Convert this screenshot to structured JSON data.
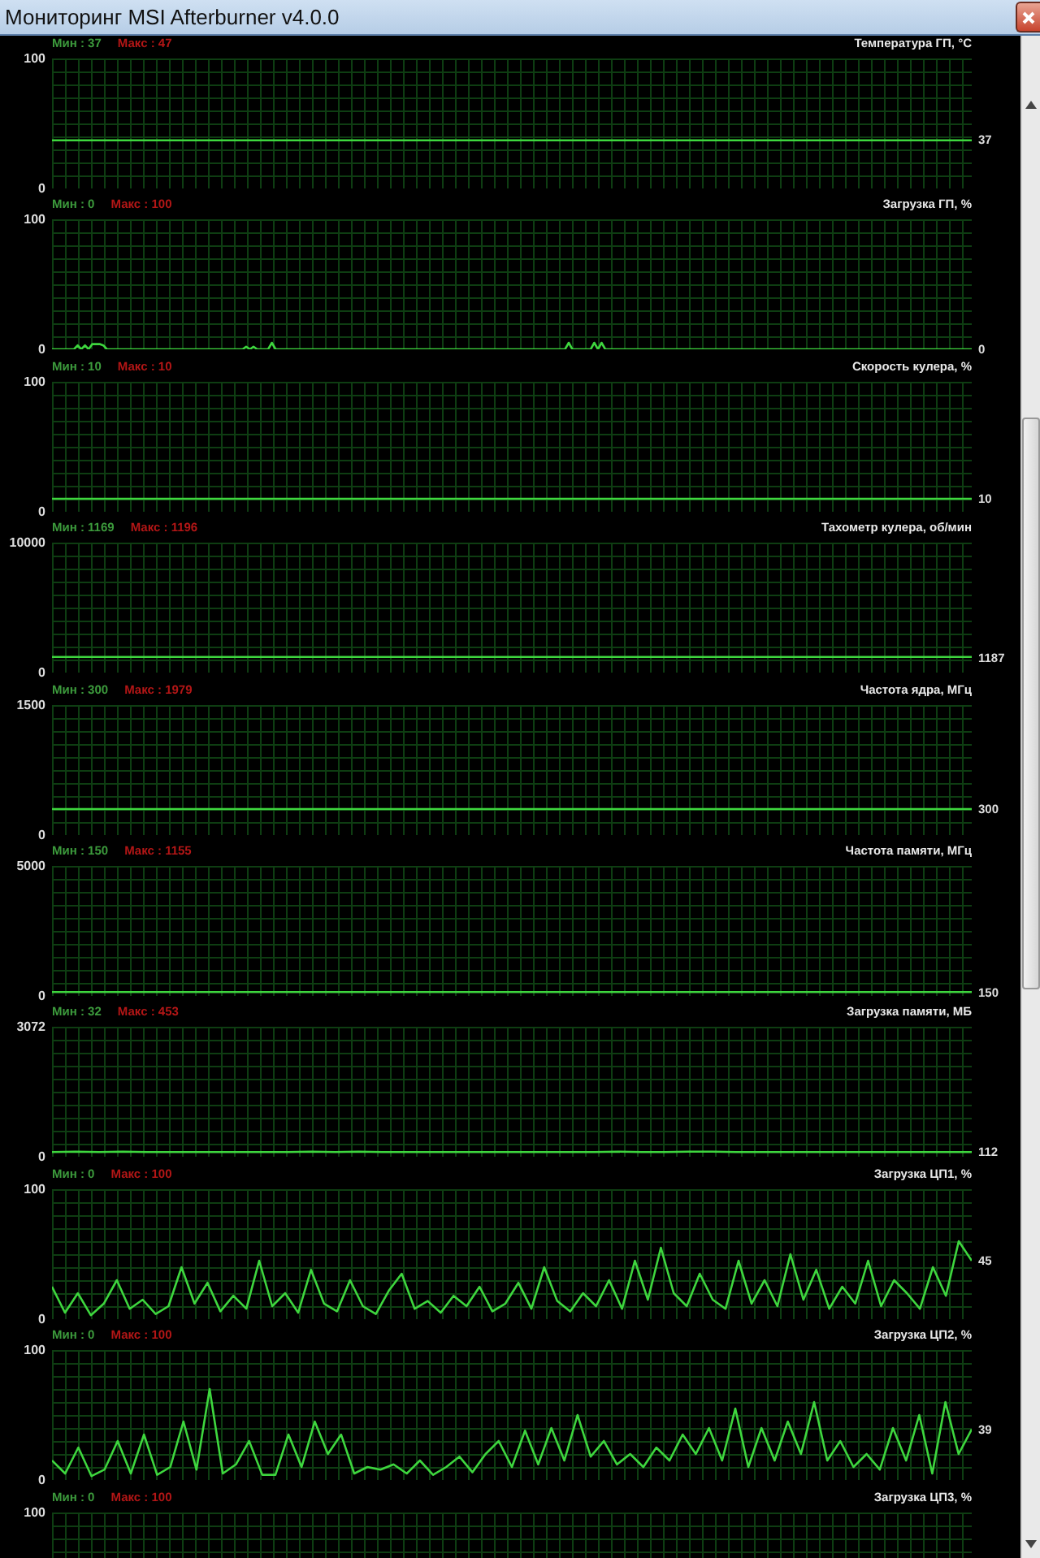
{
  "window": {
    "title": "Мониторинг MSI Afterburner v4.0.0"
  },
  "graphs": [
    {
      "min": "Мин : 37",
      "max": "Макс : 47",
      "title": "Температура ГП, °C",
      "current": "37",
      "chart_data": {
        "type": "line",
        "grid": true,
        "ylim": [
          0,
          100
        ],
        "yticks": [
          0,
          100
        ],
        "series": [
          {
            "color": "#3ed63e",
            "values": [
              37,
              37,
              37,
              37,
              37,
              37,
              37,
              37,
              37,
              37,
              37,
              37,
              37,
              37,
              37,
              37,
              37,
              37,
              37,
              37
            ]
          }
        ]
      }
    },
    {
      "min": "Мин : 0",
      "max": "Макс : 100",
      "title": "Загрузка ГП, %",
      "current": "0",
      "chart_data": {
        "type": "line",
        "grid": true,
        "ylim": [
          0,
          100
        ],
        "yticks": [
          0,
          100
        ],
        "series": [
          {
            "color": "#3ed63e",
            "values": [
              0,
              0,
              0,
              0,
              0,
              0,
              0,
              3,
              0,
              3,
              0,
              4,
              4,
              4,
              3,
              0,
              0,
              0,
              0,
              0,
              0,
              0,
              0,
              0,
              0,
              0,
              0,
              0,
              0,
              0,
              0,
              0,
              0,
              0,
              0,
              0,
              0,
              0,
              0,
              0,
              0,
              0,
              0,
              0,
              0,
              0,
              0,
              0,
              0,
              0,
              0,
              0,
              0,
              2,
              0,
              2,
              0,
              0,
              0,
              0,
              5,
              0,
              0,
              0,
              0,
              0,
              0,
              0,
              0,
              0,
              0,
              0,
              0,
              0,
              0,
              0,
              0,
              0,
              0,
              0,
              0,
              0,
              0,
              0,
              0,
              0,
              0,
              0,
              0,
              0,
              0,
              0,
              0,
              0,
              0,
              0,
              0,
              0,
              0,
              0,
              0,
              0,
              0,
              0,
              0,
              0,
              0,
              0,
              0,
              0,
              0,
              0,
              0,
              0,
              0,
              0,
              0,
              0,
              0,
              0,
              0,
              0,
              0,
              0,
              0,
              0,
              0,
              0,
              0,
              0,
              0,
              0,
              0,
              0,
              0,
              0,
              0,
              0,
              0,
              0,
              0,
              5,
              0,
              0,
              0,
              0,
              0,
              0,
              5,
              0,
              5,
              0,
              0,
              0,
              0,
              0,
              0,
              0,
              0,
              0,
              0,
              0,
              0,
              0,
              0,
              0,
              0,
              0,
              0,
              0,
              0,
              0,
              0,
              0,
              0,
              0,
              0,
              0,
              0,
              0,
              0,
              0,
              0,
              0,
              0,
              0,
              0,
              0,
              0,
              0,
              0,
              0,
              0,
              0,
              0,
              0,
              0,
              0,
              0,
              0,
              0,
              0,
              0,
              0,
              0,
              0,
              0,
              0,
              0,
              0,
              0,
              0,
              0,
              0,
              0,
              0,
              0,
              0,
              0,
              0,
              0,
              0,
              0,
              0,
              0,
              0,
              0,
              0,
              0,
              0,
              0,
              0,
              0,
              0,
              0,
              0,
              0,
              0,
              0,
              0,
              0,
              0,
              0,
              0,
              0,
              0,
              0,
              0,
              0,
              0,
              0,
              0
            ]
          }
        ]
      }
    },
    {
      "min": "Мин : 10",
      "max": "Макс : 10",
      "title": "Скорость кулера, %",
      "current": "10",
      "chart_data": {
        "type": "line",
        "grid": true,
        "ylim": [
          0,
          100
        ],
        "yticks": [
          0,
          100
        ],
        "series": [
          {
            "color": "#3ed63e",
            "values": [
              10,
              10,
              10,
              10,
              10,
              10,
              10,
              10,
              10,
              10,
              10,
              10,
              10,
              10,
              10,
              10,
              10,
              10,
              10,
              10
            ]
          }
        ]
      }
    },
    {
      "min": "Мин : 1169",
      "max": "Макс : 1196",
      "title": "Тахометр кулера, об/мин",
      "current": "1187",
      "chart_data": {
        "type": "line",
        "grid": true,
        "ylim": [
          0,
          10000
        ],
        "yticks": [
          0,
          10000
        ],
        "series": [
          {
            "color": "#3ed63e",
            "values": [
              1200,
              1200,
              1200,
              1200,
              1200,
              1200,
              1200,
              1200,
              1200,
              1200,
              1200,
              1200,
              1200,
              1200,
              1200,
              1200,
              1200,
              1200,
              1200,
              1200
            ]
          }
        ]
      }
    },
    {
      "min": "Мин : 300",
      "max": "Макс : 1979",
      "title": "Частота ядра, МГц",
      "current": "300",
      "chart_data": {
        "type": "line",
        "grid": true,
        "ylim": [
          0,
          1500
        ],
        "yticks": [
          0,
          1500
        ],
        "series": [
          {
            "color": "#3ed63e",
            "values": [
              300,
              300,
              300,
              300,
              300,
              300,
              300,
              300,
              300,
              300,
              300,
              300,
              300,
              300,
              300,
              300,
              300,
              300,
              300,
              300
            ]
          }
        ]
      }
    },
    {
      "min": "Мин : 150",
      "max": "Макс : 1155",
      "title": "Частота памяти, МГц",
      "current": "150",
      "chart_data": {
        "type": "line",
        "grid": true,
        "ylim": [
          0,
          5000
        ],
        "yticks": [
          0,
          5000
        ],
        "series": [
          {
            "color": "#3ed63e",
            "values": [
              150,
              150,
              150,
              150,
              150,
              150,
              150,
              150,
              150,
              150,
              150,
              150,
              150,
              150,
              150,
              150,
              150,
              150,
              150,
              150
            ]
          }
        ]
      }
    },
    {
      "min": "Мин : 32",
      "max": "Макс : 453",
      "title": "Загрузка памяти, МБ",
      "current": "112",
      "chart_data": {
        "type": "line",
        "grid": true,
        "ylim": [
          0,
          3072
        ],
        "yticks": [
          0,
          3072
        ],
        "series": [
          {
            "color": "#3ed63e",
            "values": [
              110,
              120,
              110,
              120,
              110,
              110,
              110,
              110,
              110,
              110,
              110,
              120,
              110,
              120,
              110,
              110,
              110,
              110,
              110,
              110,
              110,
              110,
              110,
              110,
              120,
              110,
              110,
              120,
              120,
              110,
              110,
              110,
              110,
              110,
              110,
              110,
              110,
              110,
              110,
              110
            ]
          }
        ]
      }
    },
    {
      "min": "Мин : 0",
      "max": "Макс : 100",
      "title": "Загрузка ЦП1, %",
      "current": "45",
      "chart_data": {
        "type": "line",
        "grid": true,
        "ylim": [
          0,
          100
        ],
        "yticks": [
          0,
          100
        ],
        "series": [
          {
            "color": "#3ed63e",
            "values": [
              25,
              5,
              20,
              3,
              12,
              30,
              8,
              15,
              4,
              10,
              40,
              12,
              28,
              6,
              18,
              8,
              45,
              10,
              20,
              5,
              38,
              12,
              6,
              30,
              10,
              4,
              22,
              35,
              8,
              14,
              5,
              18,
              10,
              25,
              6,
              12,
              28,
              8,
              40,
              14,
              6,
              20,
              10,
              30,
              8,
              45,
              15,
              55,
              20,
              10,
              35,
              15,
              8,
              45,
              12,
              30,
              10,
              50,
              15,
              38,
              8,
              25,
              12,
              45,
              10,
              30,
              20,
              8,
              40,
              18,
              60,
              45
            ]
          }
        ]
      }
    },
    {
      "min": "Мин : 0",
      "max": "Макс : 100",
      "title": "Загрузка ЦП2, %",
      "current": "39",
      "chart_data": {
        "type": "line",
        "grid": true,
        "ylim": [
          0,
          100
        ],
        "yticks": [
          0,
          100
        ],
        "series": [
          {
            "color": "#3ed63e",
            "values": [
              15,
              5,
              25,
              3,
              8,
              30,
              5,
              35,
              4,
              10,
              45,
              8,
              70,
              5,
              12,
              30,
              4,
              4,
              35,
              10,
              45,
              20,
              35,
              5,
              10,
              8,
              12,
              5,
              15,
              4,
              10,
              18,
              6,
              20,
              30,
              10,
              38,
              12,
              40,
              15,
              50,
              18,
              30,
              12,
              20,
              10,
              25,
              15,
              35,
              20,
              40,
              15,
              55,
              10,
              40,
              15,
              45,
              20,
              60,
              15,
              30,
              10,
              20,
              8,
              40,
              15,
              50,
              5,
              60,
              20,
              39
            ]
          }
        ]
      }
    },
    {
      "min": "Мин : 0",
      "max": "Макс : 100",
      "title": "Загрузка ЦП3, %",
      "chart_data": {
        "type": "other",
        "annotations": [
          {
            "text": "100"
          }
        ]
      }
    }
  ]
}
